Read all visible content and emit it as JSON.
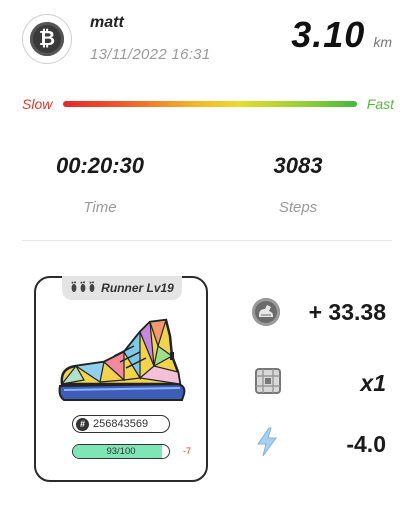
{
  "header": {
    "username": "matt",
    "datetime": "13/11/2022 16:31",
    "distance_value": "3.10",
    "distance_unit": "km",
    "avatar_glyph": "₿"
  },
  "speed": {
    "slow_label": "Slow",
    "fast_label": "Fast"
  },
  "stats": [
    {
      "value": "00:20:30",
      "label": "Time"
    },
    {
      "value": "3083",
      "label": "Steps"
    }
  ],
  "sneaker_card": {
    "runner_label": "Runner Lv19",
    "id": "256843569",
    "durability_text": "93/100",
    "durability_fraction": 0.93,
    "durability_change": "-7"
  },
  "rewards": {
    "gst": "+ 33.38",
    "mystery_box": "x1",
    "energy": "-4.0"
  },
  "colors": {
    "slow": "#e53528",
    "fast": "#56b73e",
    "durability_fill": "#7ee6b5"
  },
  "icons": [
    "bitcoin-avatar-icon",
    "footprints-icon",
    "hash-icon",
    "gst-coin-icon",
    "mystery-box-icon",
    "lightning-icon"
  ]
}
